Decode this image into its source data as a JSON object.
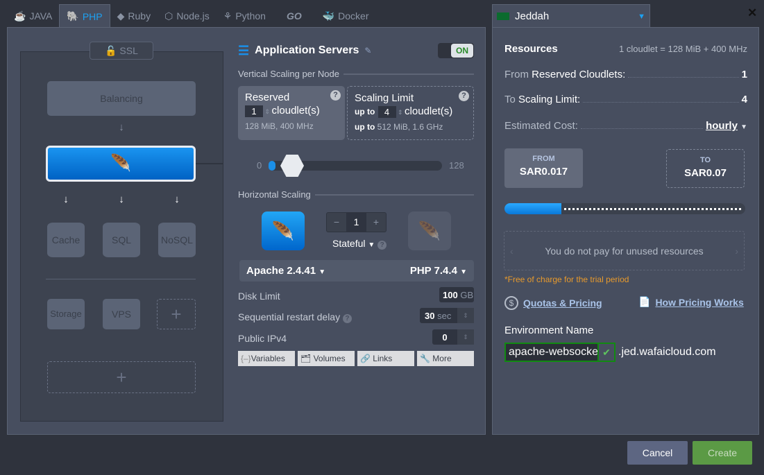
{
  "tabs": [
    {
      "label": "JAVA",
      "icon": "java-icon"
    },
    {
      "label": "PHP",
      "icon": "php-elephant-icon",
      "active": true
    },
    {
      "label": "Ruby",
      "icon": "ruby-icon"
    },
    {
      "label": "Node.js",
      "icon": "nodejs-icon"
    },
    {
      "label": "Python",
      "icon": "python-icon"
    },
    {
      "label": "GO",
      "icon": "go-icon"
    },
    {
      "label": "Docker",
      "icon": "docker-icon"
    }
  ],
  "topology": {
    "ssl": "SSL",
    "balancing": "Balancing",
    "cache": "Cache",
    "sql": "SQL",
    "nosql": "NoSQL",
    "storage": "Storage",
    "vps": "VPS",
    "add": "+"
  },
  "app": {
    "title": "Application Servers",
    "toggle": "ON",
    "vertical_title": "Vertical Scaling per Node",
    "reserved": {
      "label": "Reserved",
      "value": "1",
      "unit": "cloudlet(s)",
      "info": "128 MiB, 400 MHz"
    },
    "limit": {
      "label": "Scaling Limit",
      "prefix": "up to",
      "value": "4",
      "unit": "cloudlet(s)",
      "info_prefix": "up to",
      "info": "512 MiB, 1.6 GHz"
    },
    "slider": {
      "min": "0",
      "max": "128",
      "reserved": 1,
      "limit": 4
    },
    "horizontal_title": "Horizontal Scaling",
    "nodes": "1",
    "minus": "−",
    "plus": "+",
    "mode": "Stateful",
    "server": "Apache 2.4.41",
    "engine": "PHP 7.4.4",
    "disk": {
      "label": "Disk Limit",
      "value": "100",
      "unit": "GB"
    },
    "restart": {
      "label": "Sequential restart delay",
      "value": "30",
      "unit": "sec"
    },
    "ipv4": {
      "label": "Public IPv4",
      "value": "0"
    },
    "buttons": [
      "Variables",
      "Volumes",
      "Links",
      "More"
    ]
  },
  "region": {
    "name": "Jeddah",
    "close": "✕"
  },
  "resources": {
    "title": "Resources",
    "formula": "1 cloudlet = 128 MiB + 400 MHz",
    "from_label_a": "From",
    "from_label_b": "Reserved Cloudlets:",
    "from_value": "1",
    "to_label_a": "To",
    "to_label_b": "Scaling Limit:",
    "to_value": "4",
    "cost_label": "Estimated Cost:",
    "cost_period": "hourly",
    "from_price_label": "FROM",
    "from_price": "SAR0.017",
    "to_price_label": "TO",
    "to_price": "SAR0.07",
    "note": "You do not pay for unused resources",
    "trial": "*Free of charge for the trial period",
    "quotas": "Quotas & Pricing",
    "how": "How Pricing Works",
    "env_label": "Environment Name",
    "env_value": "apache-websocket",
    "domain": ".jed.wafaicloud.com"
  },
  "footer": {
    "cancel": "Cancel",
    "create": "Create"
  },
  "colors": {
    "accent": "#1a8fe8",
    "create": "#5b9a45",
    "trial": "#e89a2c"
  }
}
